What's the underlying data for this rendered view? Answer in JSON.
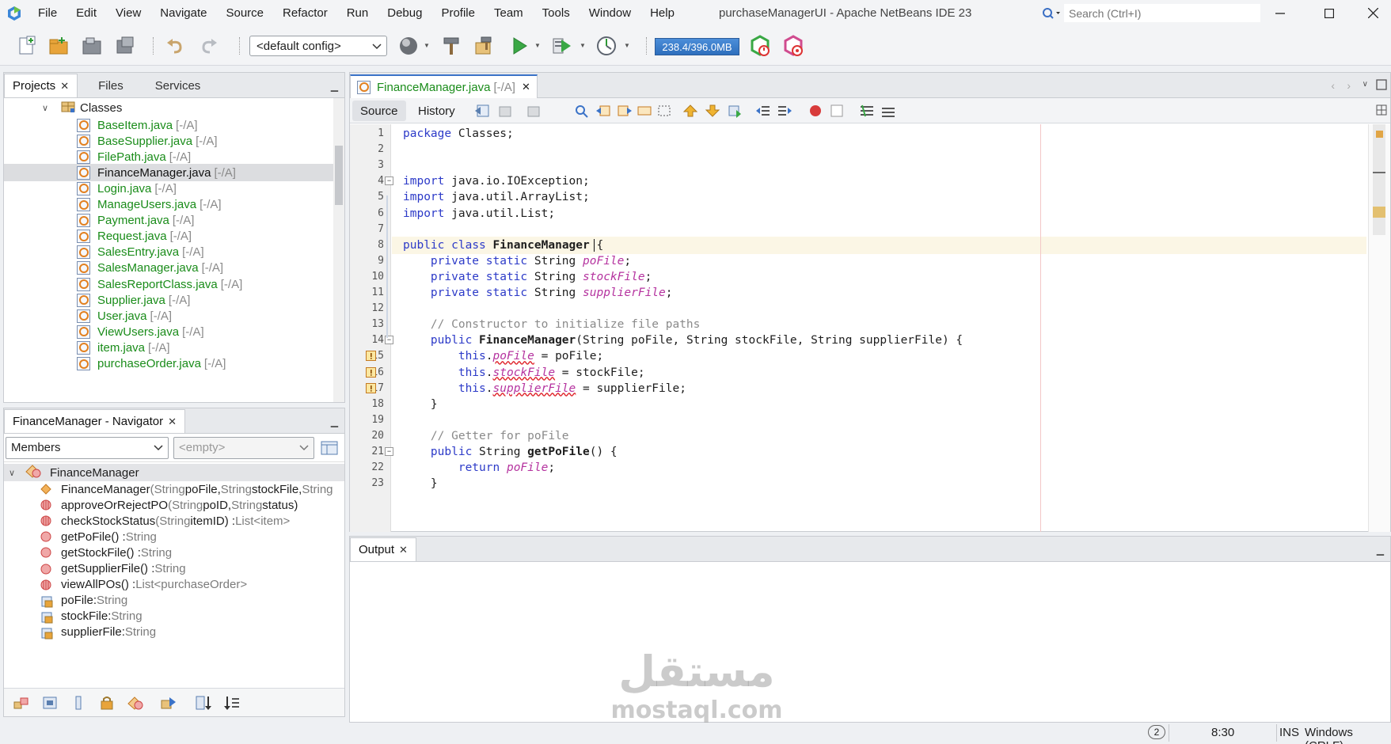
{
  "window": {
    "title": "purchaseManagerUI - Apache NetBeans IDE 23",
    "controls": [
      "minimize",
      "maximize",
      "close"
    ]
  },
  "menu": [
    "File",
    "Edit",
    "View",
    "Navigate",
    "Source",
    "Refactor",
    "Run",
    "Debug",
    "Profile",
    "Team",
    "Tools",
    "Window",
    "Help"
  ],
  "search": {
    "placeholder": "Search (Ctrl+I)"
  },
  "toolbar": {
    "config": "<default config>",
    "memory": "238.4/396.0MB",
    "icons": [
      "new-file-icon",
      "new-project-icon",
      "open-project-icon",
      "close-project-icon",
      "undo-icon",
      "redo-icon",
      "browser-globe-icon",
      "build-hammer-icon",
      "clean-build-icon",
      "run-icon",
      "debug-icon",
      "profile-icon",
      "gc-icon",
      "profiler-snapshot-icon"
    ]
  },
  "projects_panel": {
    "tabs": [
      "Projects",
      "Files",
      "Services"
    ],
    "folder": "Classes",
    "files": [
      {
        "name": "BaseItem.java",
        "status": "[-/A]"
      },
      {
        "name": "BaseSupplier.java",
        "status": "[-/A]"
      },
      {
        "name": "FilePath.java",
        "status": "[-/A]"
      },
      {
        "name": "FinanceManager.java",
        "status": "[-/A]",
        "selected": true
      },
      {
        "name": "Login.java",
        "status": "[-/A]"
      },
      {
        "name": "ManageUsers.java",
        "status": "[-/A]"
      },
      {
        "name": "Payment.java",
        "status": "[-/A]"
      },
      {
        "name": "Request.java",
        "status": "[-/A]"
      },
      {
        "name": "SalesEntry.java",
        "status": "[-/A]"
      },
      {
        "name": "SalesManager.java",
        "status": "[-/A]"
      },
      {
        "name": "SalesReportClass.java",
        "status": "[-/A]"
      },
      {
        "name": "Supplier.java",
        "status": "[-/A]"
      },
      {
        "name": "User.java",
        "status": "[-/A]"
      },
      {
        "name": "ViewUsers.java",
        "status": "[-/A]"
      },
      {
        "name": "item.java",
        "status": "[-/A]"
      },
      {
        "name": "purchaseOrder.java",
        "status": "[-/A]"
      }
    ]
  },
  "navigator": {
    "title": "FinanceManager - Navigator",
    "filter": "Members",
    "filter2": "<empty>",
    "class_name": "FinanceManager",
    "members": [
      {
        "kind": "constructor",
        "name": "FinanceManager",
        "sig": [
          [
            "(",
            "g"
          ],
          [
            "String",
            "g"
          ],
          [
            " poFile, ",
            "b"
          ],
          [
            "String",
            "g"
          ],
          [
            " stockFile, ",
            "b"
          ],
          [
            "String",
            "g"
          ]
        ]
      },
      {
        "kind": "method-pkg",
        "name": "approveOrRejectPO",
        "sig": [
          [
            "(",
            "g"
          ],
          [
            "String",
            "g"
          ],
          [
            " poID, ",
            "b"
          ],
          [
            "String",
            "g"
          ],
          [
            " status)",
            "b"
          ]
        ]
      },
      {
        "kind": "method-pkg",
        "name": "checkStockStatus",
        "sig": [
          [
            "(",
            "g"
          ],
          [
            "String",
            "g"
          ],
          [
            " itemID) : ",
            "b"
          ],
          [
            "List<item>",
            "g"
          ]
        ]
      },
      {
        "kind": "method",
        "name": "getPoFile",
        "sig": [
          [
            "() : ",
            "b"
          ],
          [
            "String",
            "g"
          ]
        ]
      },
      {
        "kind": "method",
        "name": "getStockFile",
        "sig": [
          [
            "() : ",
            "b"
          ],
          [
            "String",
            "g"
          ]
        ]
      },
      {
        "kind": "method",
        "name": "getSupplierFile",
        "sig": [
          [
            "() : ",
            "b"
          ],
          [
            "String",
            "g"
          ]
        ]
      },
      {
        "kind": "method-pkg",
        "name": "viewAllPOs",
        "sig": [
          [
            "() : ",
            "b"
          ],
          [
            "List<purchaseOrder>",
            "g"
          ]
        ]
      },
      {
        "kind": "field",
        "name": "poFile",
        "sig": [
          [
            " : ",
            "b"
          ],
          [
            "String",
            "g"
          ]
        ]
      },
      {
        "kind": "field",
        "name": "stockFile",
        "sig": [
          [
            " : ",
            "b"
          ],
          [
            "String",
            "g"
          ]
        ]
      },
      {
        "kind": "field",
        "name": "supplierFile",
        "sig": [
          [
            " : ",
            "b"
          ],
          [
            "String",
            "g"
          ]
        ]
      }
    ]
  },
  "editor": {
    "tab_name": "FinanceManager.java",
    "tab_status": "[-/A]",
    "view_tabs": [
      "Source",
      "History"
    ],
    "current_line": 8,
    "lines": [
      {
        "n": "1",
        "c": [
          [
            "package",
            "kw"
          ],
          [
            " Classes;",
            ""
          ]
        ]
      },
      {
        "n": "2",
        "c": []
      },
      {
        "n": "3",
        "c": []
      },
      {
        "n": "4",
        "fold": true,
        "c": [
          [
            "import",
            "kw"
          ],
          [
            " java.io.IOException;",
            ""
          ]
        ]
      },
      {
        "n": "5",
        "c": [
          [
            "import",
            "kw"
          ],
          [
            " java.util.ArrayList;",
            ""
          ]
        ]
      },
      {
        "n": "6",
        "c": [
          [
            "import",
            "kw"
          ],
          [
            " java.util.List;",
            ""
          ]
        ]
      },
      {
        "n": "7",
        "c": []
      },
      {
        "n": "8",
        "c": [
          [
            "public",
            "kw"
          ],
          [
            " ",
            ""
          ],
          [
            "class",
            "kw"
          ],
          [
            " ",
            ""
          ],
          [
            "FinanceManager",
            "bold"
          ],
          [
            " {",
            ""
          ]
        ]
      },
      {
        "n": "9",
        "c": [
          [
            "    ",
            ""
          ],
          [
            "private",
            "kw"
          ],
          [
            " ",
            ""
          ],
          [
            "static",
            "kw"
          ],
          [
            " String ",
            ""
          ],
          [
            "poFile",
            "fld"
          ],
          [
            ";",
            ""
          ]
        ]
      },
      {
        "n": "10",
        "c": [
          [
            "    ",
            ""
          ],
          [
            "private",
            "kw"
          ],
          [
            " ",
            ""
          ],
          [
            "static",
            "kw"
          ],
          [
            " String ",
            ""
          ],
          [
            "stockFile",
            "fld"
          ],
          [
            ";",
            ""
          ]
        ]
      },
      {
        "n": "11",
        "c": [
          [
            "    ",
            ""
          ],
          [
            "private",
            "kw"
          ],
          [
            " ",
            ""
          ],
          [
            "static",
            "kw"
          ],
          [
            " String ",
            ""
          ],
          [
            "supplierFile",
            "fld"
          ],
          [
            ";",
            ""
          ]
        ]
      },
      {
        "n": "12",
        "c": []
      },
      {
        "n": "13",
        "c": [
          [
            "    ",
            ""
          ],
          [
            "// Constructor to initialize file paths",
            "cm"
          ]
        ]
      },
      {
        "n": "14",
        "fold": true,
        "c": [
          [
            "    ",
            ""
          ],
          [
            "public",
            "kw"
          ],
          [
            " ",
            ""
          ],
          [
            "FinanceManager",
            "bold"
          ],
          [
            "(String poFile, String stockFile, String supplierFile) {",
            ""
          ]
        ]
      },
      {
        "n": "15",
        "warn": true,
        "c": [
          [
            "        ",
            ""
          ],
          [
            "this",
            "kw"
          ],
          [
            ".",
            ""
          ],
          [
            "poFile",
            "fld squig"
          ],
          [
            " = poFile;",
            ""
          ]
        ]
      },
      {
        "n": "16",
        "warn": true,
        "c": [
          [
            "        ",
            ""
          ],
          [
            "this",
            "kw"
          ],
          [
            ".",
            ""
          ],
          [
            "stockFile",
            "fld squig"
          ],
          [
            " = stockFile;",
            ""
          ]
        ]
      },
      {
        "n": "17",
        "warn": true,
        "c": [
          [
            "        ",
            ""
          ],
          [
            "this",
            "kw"
          ],
          [
            ".",
            ""
          ],
          [
            "supplierFile",
            "fld squig"
          ],
          [
            " = supplierFile;",
            ""
          ]
        ]
      },
      {
        "n": "18",
        "c": [
          [
            "    }",
            ""
          ]
        ]
      },
      {
        "n": "19",
        "c": []
      },
      {
        "n": "20",
        "c": [
          [
            "    ",
            ""
          ],
          [
            "// Getter for poFile",
            "cm"
          ]
        ]
      },
      {
        "n": "21",
        "fold": true,
        "c": [
          [
            "    ",
            ""
          ],
          [
            "public",
            "kw"
          ],
          [
            " String ",
            ""
          ],
          [
            "getPoFile",
            "bold"
          ],
          [
            "() {",
            ""
          ]
        ]
      },
      {
        "n": "22",
        "c": [
          [
            "        ",
            ""
          ],
          [
            "return",
            "kw"
          ],
          [
            " ",
            ""
          ],
          [
            "poFile",
            "fld"
          ],
          [
            ";",
            ""
          ]
        ]
      },
      {
        "n": "23",
        "c": [
          [
            "    }",
            ""
          ]
        ]
      }
    ]
  },
  "output": {
    "tab": "Output"
  },
  "status_bar": {
    "notifications": "2",
    "position": "8:30",
    "mode": "INS",
    "line_endings": "Windows (CRLF)"
  },
  "watermark": {
    "arabic": "مستقل",
    "latin": "mostaql.com"
  },
  "colors": {
    "keyword": "#2c3ac8",
    "field": "#b5339f",
    "comment": "#8a8a8a",
    "file_green": "#1a8c1a",
    "current_line": "#fbf6e5"
  }
}
